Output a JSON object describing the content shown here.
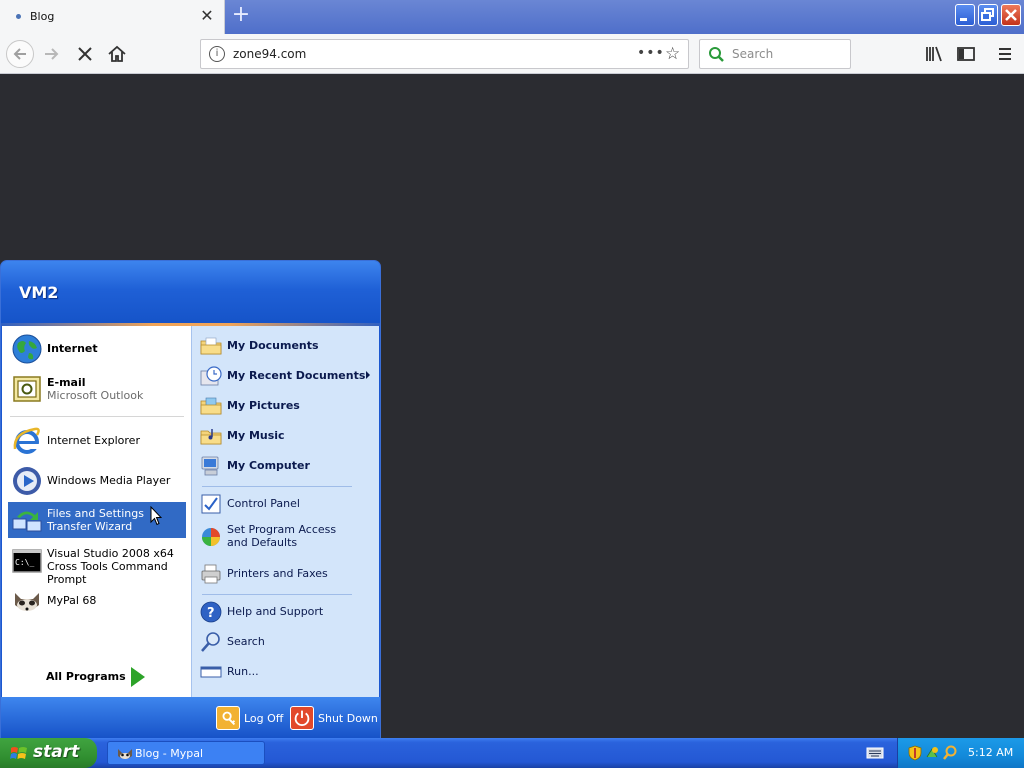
{
  "browser": {
    "tab_title": "Blog",
    "url": "zone94.com",
    "search_placeholder": "Search"
  },
  "start_menu": {
    "user": "VM2",
    "pinned": [
      {
        "label": "Internet",
        "icon": "globe-icon"
      },
      {
        "label": "E-mail",
        "sub": "Microsoft Outlook",
        "icon": "outlook-icon"
      }
    ],
    "recent": [
      {
        "label": "Internet Explorer",
        "icon": "internet-explorer-icon"
      },
      {
        "label": "Windows Media Player",
        "icon": "media-player-icon"
      },
      {
        "label": "Files and Settings Transfer Wizard",
        "icon": "transfer-wizard-icon",
        "selected": true
      },
      {
        "label": "Visual Studio 2008 x64 Cross Tools Command Prompt",
        "icon": "command-prompt-icon"
      },
      {
        "label": "MyPal 68",
        "icon": "mypal-icon"
      }
    ],
    "all_programs": "All Programs",
    "places": [
      {
        "label": "My Documents",
        "icon": "folder-documents-icon"
      },
      {
        "label": "My Recent Documents",
        "icon": "recent-documents-icon",
        "submenu": true
      },
      {
        "label": "My Pictures",
        "icon": "folder-pictures-icon"
      },
      {
        "label": "My Music",
        "icon": "folder-music-icon"
      },
      {
        "label": "My Computer",
        "icon": "computer-icon"
      }
    ],
    "settings": [
      {
        "label": "Control Panel",
        "icon": "control-panel-icon"
      },
      {
        "label": "Set Program Access and Defaults",
        "icon": "program-access-icon"
      },
      {
        "label": "Printers and Faxes",
        "icon": "printer-icon"
      }
    ],
    "help": [
      {
        "label": "Help and Support",
        "icon": "help-icon"
      },
      {
        "label": "Search",
        "icon": "search-icon"
      },
      {
        "label": "Run...",
        "icon": "run-icon"
      }
    ],
    "log_off": "Log Off",
    "shut_down": "Shut Down"
  },
  "taskbar": {
    "start": "start",
    "task": "Blog - Mypal",
    "clock": "5:12 AM"
  }
}
